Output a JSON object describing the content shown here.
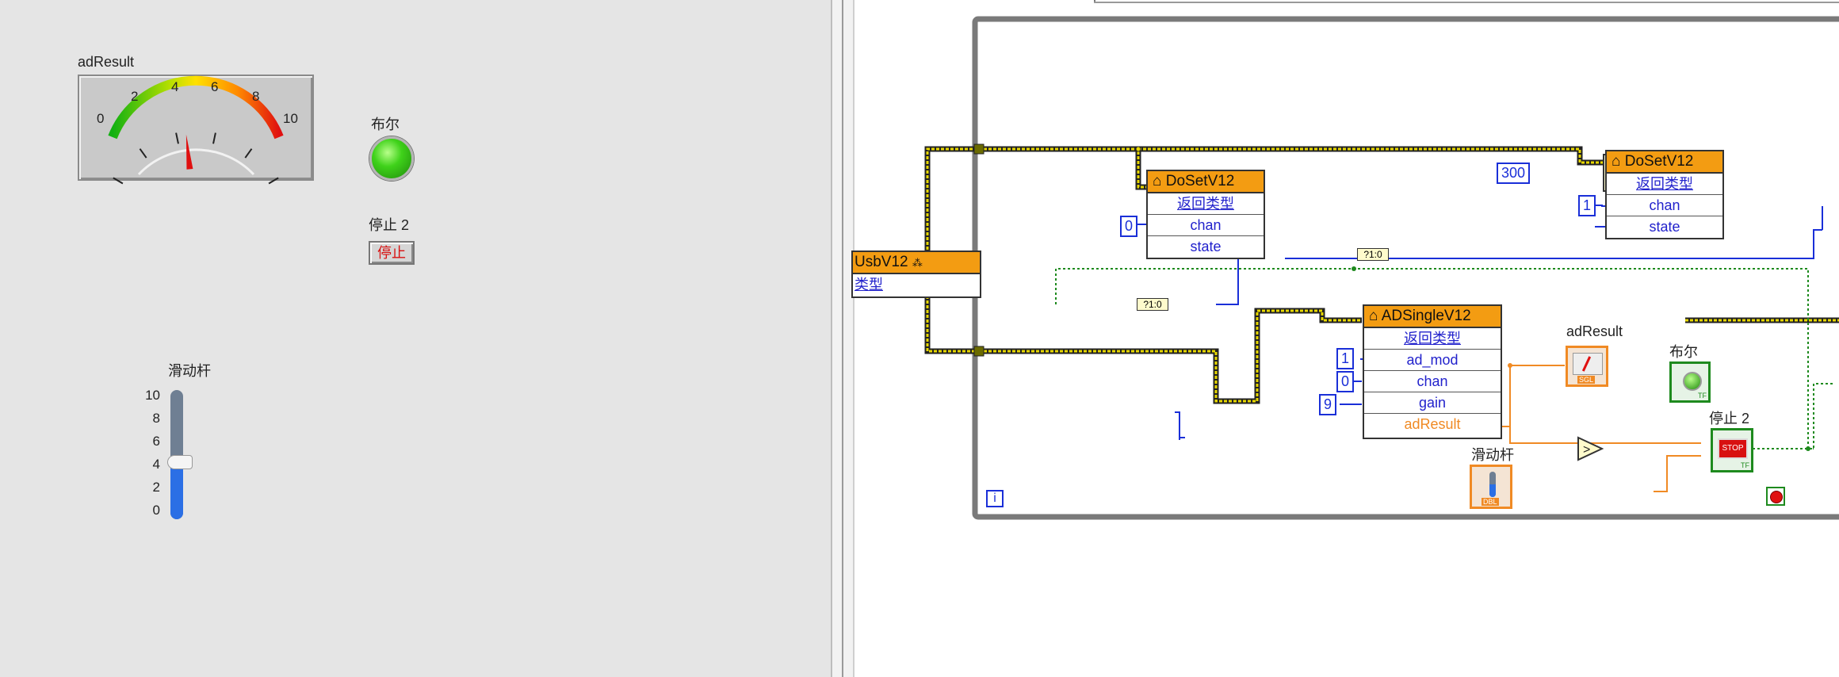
{
  "front_panel": {
    "gauge": {
      "label": "adResult",
      "ticks": [
        "0",
        "2",
        "4",
        "6",
        "8",
        "10"
      ],
      "value": 4.5,
      "min": 0,
      "max": 10
    },
    "led": {
      "label": "布尔",
      "state": "on",
      "color": "#3fd21a"
    },
    "stop": {
      "label": "停止 2",
      "button_text": "停止"
    },
    "slider": {
      "label": "滑动杆",
      "ticks": [
        "10",
        "8",
        "6",
        "4",
        "2",
        "0"
      ],
      "value": 4.2,
      "min": 0,
      "max": 10
    }
  },
  "block_diagram": {
    "left_node": {
      "title": "UsbV12",
      "row": "类型"
    },
    "doset_a": {
      "title": "DoSetV12",
      "rows": [
        "返回类型",
        "chan",
        "state"
      ]
    },
    "doset_b": {
      "title": "DoSetV12",
      "rows": [
        "返回类型",
        "chan",
        "state"
      ]
    },
    "adsingle": {
      "title": "ADSingleV12",
      "rows": [
        "返回类型",
        "ad_mod",
        "chan",
        "gain",
        "adResult"
      ]
    },
    "constants": {
      "doset_a_chan": "0",
      "doset_b_chan": "1",
      "wait_ms": "300",
      "ad_mod": "1",
      "ad_chan": "0",
      "gain": "9"
    },
    "terminals": {
      "adresult": "adResult",
      "bool": "布尔",
      "stop": "停止 2",
      "slider": "滑动杆"
    },
    "bundle_tag_a": "?1:0",
    "bundle_tag_b": "?1:0",
    "loop_index": "i",
    "stop_icon_text": "STOP",
    "tf_text": "TF",
    "dbl_text": "DBL",
    "sgl_text": "SGL",
    "colors": {
      "error_wire": "#e8d800",
      "node_header": "#f39c12",
      "numeric_const": "#1a2fd8",
      "dbl_wire": "#f08a24",
      "bool_wire": "#1e8a1e"
    }
  }
}
